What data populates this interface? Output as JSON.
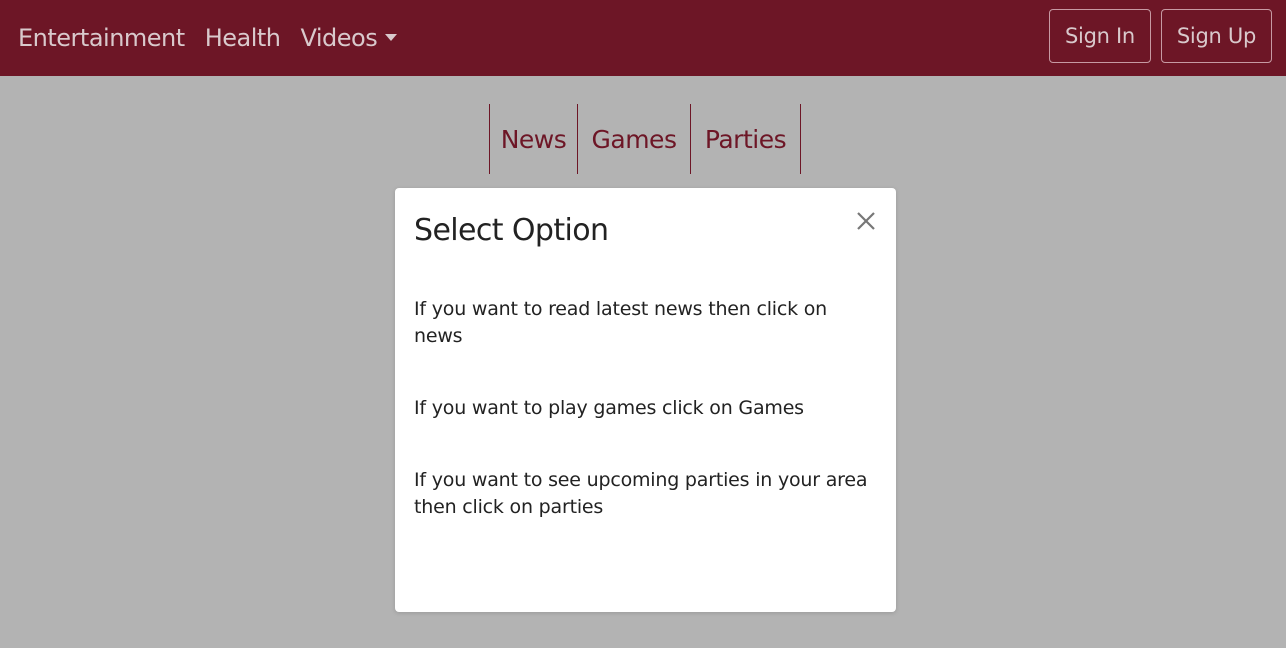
{
  "navbar": {
    "links": [
      "Entertainment",
      "Health",
      "Videos"
    ],
    "sign_in": "Sign In",
    "sign_up": "Sign Up",
    "color": "#6d1626"
  },
  "subtabs": [
    "News",
    "Games",
    "Parties"
  ],
  "modal": {
    "title": "Select Option",
    "close_icon": "close-icon",
    "lines": [
      "If you want to read latest news then click on news",
      "If you want to play games click on Games",
      "If you want to see upcoming parties in your area then click on parties"
    ]
  }
}
